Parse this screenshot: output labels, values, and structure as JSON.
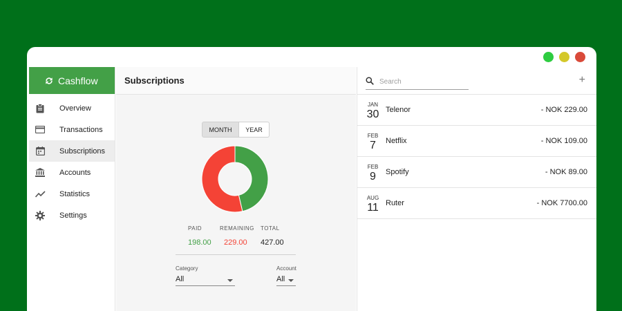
{
  "window": {
    "controls": [
      {
        "name": "maximize",
        "color": "#2ecc40"
      },
      {
        "name": "minimize",
        "color": "#d4c82a"
      },
      {
        "name": "close",
        "color": "#d94a3a"
      }
    ]
  },
  "sidebar": {
    "brand": "Cashflow",
    "brand_color": "#43a047",
    "items": [
      {
        "label": "Overview",
        "icon": "clipboard-icon"
      },
      {
        "label": "Transactions",
        "icon": "credit-card-icon"
      },
      {
        "label": "Subscriptions",
        "icon": "calendar-icon",
        "active": true
      },
      {
        "label": "Accounts",
        "icon": "bank-icon"
      },
      {
        "label": "Statistics",
        "icon": "trending-icon"
      },
      {
        "label": "Settings",
        "icon": "gear-icon"
      }
    ]
  },
  "center": {
    "title": "Subscriptions",
    "toggle": {
      "month": "MONTH",
      "year": "YEAR",
      "selected": "MONTH"
    },
    "summary": {
      "paid_label": "PAID",
      "paid_value": "198.00",
      "paid_color": "#43a047",
      "remaining_label": "REMAINING",
      "remaining_value": "229.00",
      "remaining_color": "#f44336",
      "total_label": "TOTAL",
      "total_value": "427.00"
    },
    "filters": {
      "category_label": "Category",
      "category_value": "All",
      "account_label": "Account",
      "account_value": "All"
    }
  },
  "chart_data": {
    "type": "pie",
    "categories": [
      "PAID",
      "REMAINING"
    ],
    "values": [
      198.0,
      229.0
    ],
    "colors": [
      "#43a047",
      "#f44336"
    ]
  },
  "right": {
    "search_placeholder": "Search",
    "add_label": "+",
    "subscriptions": [
      {
        "month": "JAN",
        "day": "30",
        "name": "Telenor",
        "amount": "- NOK 229.00"
      },
      {
        "month": "FEB",
        "day": "7",
        "name": "Netflix",
        "amount": "- NOK 109.00"
      },
      {
        "month": "FEB",
        "day": "9",
        "name": "Spotify",
        "amount": "- NOK 89.00"
      },
      {
        "month": "AUG",
        "day": "11",
        "name": "Ruter",
        "amount": "- NOK 7700.00"
      }
    ]
  }
}
